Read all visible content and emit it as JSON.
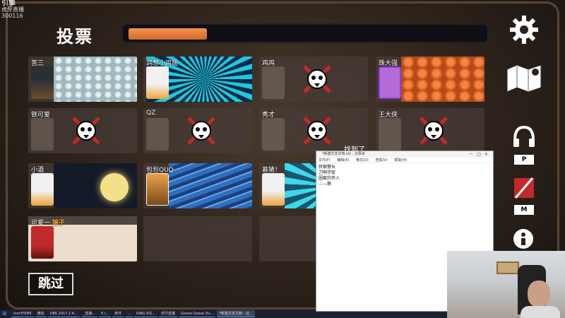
{
  "corner": {
    "logo_text": "引擎",
    "sub_text": "虎牙直播",
    "id_text": "300116"
  },
  "header": {
    "title": "投票",
    "timer_progress": 0.22
  },
  "players": [
    {
      "name": "苦三",
      "status": "alive",
      "background": "net"
    },
    {
      "name": "鸽想小鸡翅",
      "status": "alive",
      "background": "burst"
    },
    {
      "name": "鸡鸡",
      "status": "dead"
    },
    {
      "name": "珠大强",
      "status": "alive",
      "background": "meat"
    },
    {
      "name": "铁可爱",
      "status": "dead"
    },
    {
      "name": "QZ",
      "status": "dead"
    },
    {
      "name": "秀才",
      "status": "dead"
    },
    {
      "name": "王大侠",
      "status": "dead"
    },
    {
      "name": "小酒",
      "status": "alive",
      "background": "moon"
    },
    {
      "name": "包包QUQ",
      "status": "alive",
      "background": "feather"
    },
    {
      "name": "慕猪！",
      "status": "alive",
      "background": "rays"
    },
    {
      "prefix": "可爱一",
      "name": "锦子",
      "status": "reporter",
      "background": "cream"
    }
  ],
  "found_label": "找到了",
  "skip_button": "跳过",
  "side": {
    "settings_icon": "gear-icon",
    "map_icon": "map-icon",
    "voice_key": "P",
    "mic_key": "M",
    "info_icon": "info-icon"
  },
  "notepad": {
    "title": "*新建文本文档.txt - 记事本",
    "menu": [
      "文件(F)",
      "编辑(E)",
      "格式(O)",
      "查看(V)",
      "帮助(H)"
    ],
    "lines": [
      "铁锹警长",
      "刀哨学徒",
      "圈套的传人",
      "——鹅"
    ]
  },
  "taskbar": {
    "items": [
      "IconFIXME",
      "微信",
      "DBS 2017.2.4...",
      "_直播...",
      "E:\\...",
      "软件",
      "...",
      "KING 9月...",
      "虎牙直播",
      "Goose Goose Du...",
      "*新建文本文档 - 记..."
    ]
  },
  "colors": {
    "timer": "#e8803c",
    "accent": "#f6a53a",
    "dead_cross": "#c22a2a"
  }
}
